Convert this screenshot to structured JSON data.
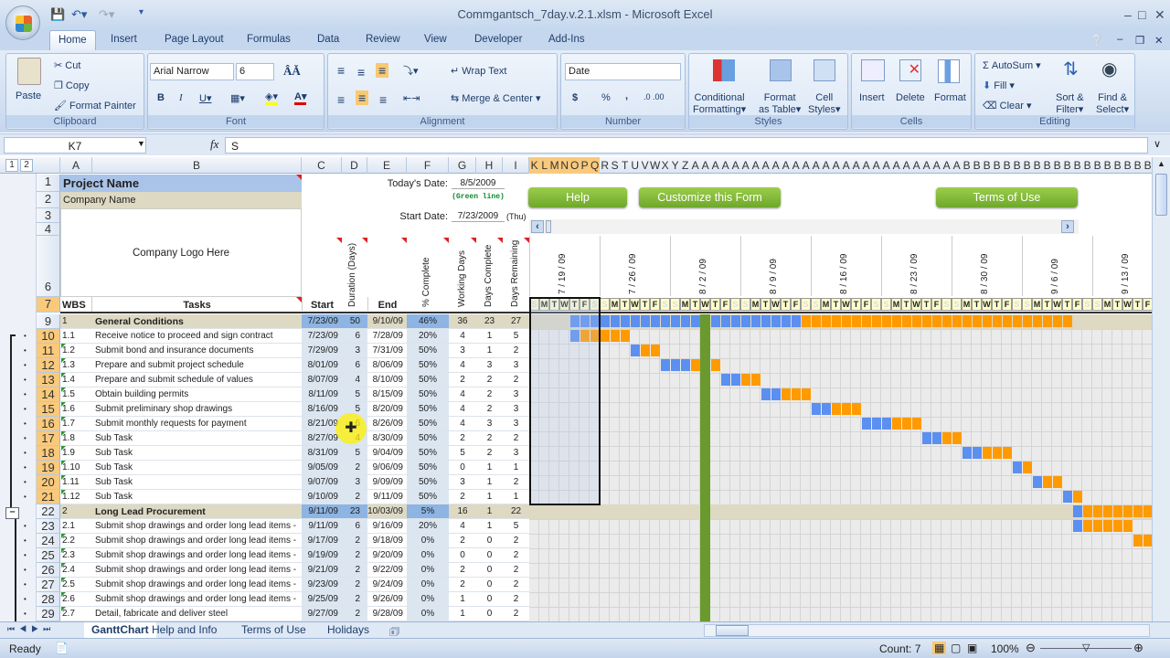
{
  "window": {
    "title": "Commgantsch_7day.v.2.1.xlsm - Microsoft Excel"
  },
  "ribbon": {
    "tabs": [
      "Home",
      "Insert",
      "Page Layout",
      "Formulas",
      "Data",
      "Review",
      "View",
      "Developer",
      "Add-Ins"
    ],
    "active_tab": "Home",
    "clipboard": {
      "label": "Clipboard",
      "paste": "Paste",
      "cut": "Cut",
      "copy": "Copy",
      "format_painter": "Format Painter"
    },
    "font": {
      "label": "Font",
      "font_name": "Arial Narrow",
      "font_size": "6"
    },
    "alignment": {
      "label": "Alignment",
      "wrap_text": "Wrap Text",
      "merge_center": "Merge & Center"
    },
    "number": {
      "label": "Number",
      "format": "Date",
      "currency": "$",
      "percent": "%",
      "comma": ","
    },
    "styles": {
      "label": "Styles",
      "conditional": "Conditional",
      "conditional2": "Formatting",
      "format_table": "Format",
      "format_table2": "as Table",
      "cell_styles": "Cell",
      "cell_styles2": "Styles"
    },
    "cells": {
      "label": "Cells",
      "insert": "Insert",
      "delete": "Delete",
      "format": "Format"
    },
    "editing": {
      "label": "Editing",
      "autosum": "AutoSum",
      "fill": "Fill",
      "clear": "Clear",
      "sort": "Sort &",
      "sort2": "Filter",
      "find": "Find &",
      "find2": "Select"
    }
  },
  "formula_bar": {
    "name_box": "K7",
    "fx": "fx",
    "value": "S"
  },
  "columns": {
    "fixed": [
      "A",
      "B",
      "C",
      "D",
      "E",
      "F",
      "G",
      "H",
      "I"
    ],
    "gantt": "KLMNOPQRSTUVWXYZAAAAAAAAAAAAAAAAAAAAAAAAAAABBBBBBBBBBBBBBBBBBBBB",
    "selected": "KLMNOPQ"
  },
  "outline_levels": [
    "1",
    "2"
  ],
  "sheet": {
    "project_name": "Project Name",
    "company_name": "Company Name",
    "logo_placeholder": "Company Logo Here",
    "todays_date_label": "Today's Date:",
    "todays_date": "8/5/2009",
    "green_line_note": "(Green line)",
    "start_date_label": "Start Date:",
    "start_date": "7/23/2009",
    "start_day": "(Thu)",
    "buttons": {
      "help": "Help",
      "customize": "Customize this Form",
      "terms": "Terms of Use"
    },
    "headers": {
      "wbs": "WBS",
      "tasks": "Tasks",
      "start": "Start",
      "duration": "Duration (Days)",
      "end": "End",
      "pct": "% Complete",
      "working": "Working Days",
      "complete": "Days Complete",
      "remaining": "Days Remaining"
    },
    "header_row_numbers": [
      "1",
      "2",
      "3",
      "4",
      "6",
      "7"
    ],
    "timeline_start": "2009-07-19",
    "today": "2009-08-05",
    "weeks": [
      "7 / 19 / 09",
      "7 / 26 / 09",
      "8 / 2 / 09",
      "8 / 9 / 09",
      "8 / 16 / 09",
      "8 / 23 / 09",
      "8 / 30 / 09",
      "9 / 6 / 09",
      "9 / 13 / 09"
    ],
    "day_letters": [
      "S",
      "M",
      "T",
      "W",
      "T",
      "F",
      "S"
    ],
    "colors": {
      "complete": "#5b8ff0",
      "remaining": "#ff9a00",
      "today_line": "#6a9a2e",
      "summary_row": "#ddd9c3",
      "date_col": "#dce6f1",
      "summary_date_col": "#8db4e2"
    },
    "rows": [
      {
        "row": "9",
        "wbs": "1",
        "task": "General Conditions",
        "start": "7/23/09",
        "dur": "50",
        "end": "9/10/09",
        "pct": "46%",
        "work": "36",
        "done": "23",
        "rem": "27",
        "summary": true,
        "iso": "2009-07-23"
      },
      {
        "row": "10",
        "wbs": "1.1",
        "task": "Receive notice to proceed and sign contract",
        "start": "7/23/09",
        "dur": "6",
        "end": "7/28/09",
        "pct": "20%",
        "work": "4",
        "done": "1",
        "rem": "5",
        "iso": "2009-07-23"
      },
      {
        "row": "11",
        "wbs": "1.2",
        "task": "Submit bond and insurance documents",
        "start": "7/29/09",
        "dur": "3",
        "end": "7/31/09",
        "pct": "50%",
        "work": "3",
        "done": "1",
        "rem": "2",
        "iso": "2009-07-29"
      },
      {
        "row": "12",
        "wbs": "1.3",
        "task": "Prepare and submit project schedule",
        "start": "8/01/09",
        "dur": "6",
        "end": "8/06/09",
        "pct": "50%",
        "work": "4",
        "done": "3",
        "rem": "3",
        "iso": "2009-08-01"
      },
      {
        "row": "13",
        "wbs": "1.4",
        "task": "Prepare and submit schedule of values",
        "start": "8/07/09",
        "dur": "4",
        "end": "8/10/09",
        "pct": "50%",
        "work": "2",
        "done": "2",
        "rem": "2",
        "iso": "2009-08-07"
      },
      {
        "row": "14",
        "wbs": "1.5",
        "task": "Obtain building permits",
        "start": "8/11/09",
        "dur": "5",
        "end": "8/15/09",
        "pct": "50%",
        "work": "4",
        "done": "2",
        "rem": "3",
        "iso": "2009-08-11"
      },
      {
        "row": "15",
        "wbs": "1.6",
        "task": "Submit preliminary shop drawings",
        "start": "8/16/09",
        "dur": "5",
        "end": "8/20/09",
        "pct": "50%",
        "work": "4",
        "done": "2",
        "rem": "3",
        "iso": "2009-08-16"
      },
      {
        "row": "16",
        "wbs": "1.7",
        "task": "Submit monthly requests for payment",
        "start": "8/21/09",
        "dur": "6",
        "end": "8/26/09",
        "pct": "50%",
        "work": "4",
        "done": "3",
        "rem": "3",
        "iso": "2009-08-21"
      },
      {
        "row": "17",
        "wbs": "1.8",
        "task": "Sub Task",
        "start": "8/27/09",
        "dur": "4",
        "end": "8/30/09",
        "pct": "50%",
        "work": "2",
        "done": "2",
        "rem": "2",
        "iso": "2009-08-27"
      },
      {
        "row": "18",
        "wbs": "1.9",
        "task": "Sub Task",
        "start": "8/31/09",
        "dur": "5",
        "end": "9/04/09",
        "pct": "50%",
        "work": "5",
        "done": "2",
        "rem": "3",
        "iso": "2009-08-31"
      },
      {
        "row": "19",
        "wbs": "1.10",
        "task": "Sub Task",
        "start": "9/05/09",
        "dur": "2",
        "end": "9/06/09",
        "pct": "50%",
        "work": "0",
        "done": "1",
        "rem": "1",
        "iso": "2009-09-05"
      },
      {
        "row": "20",
        "wbs": "1.11",
        "task": "Sub Task",
        "start": "9/07/09",
        "dur": "3",
        "end": "9/09/09",
        "pct": "50%",
        "work": "3",
        "done": "1",
        "rem": "2",
        "iso": "2009-09-07"
      },
      {
        "row": "21",
        "wbs": "1.12",
        "task": "Sub Task",
        "start": "9/10/09",
        "dur": "2",
        "end": "9/11/09",
        "pct": "50%",
        "work": "2",
        "done": "1",
        "rem": "1",
        "iso": "2009-09-10"
      },
      {
        "row": "22",
        "wbs": "2",
        "task": "Long Lead Procurement",
        "start": "9/11/09",
        "dur": "23",
        "end": "10/03/09",
        "pct": "5%",
        "work": "16",
        "done": "1",
        "rem": "22",
        "summary": true,
        "iso": "2009-09-11"
      },
      {
        "row": "23",
        "wbs": "2.1",
        "task": "Submit shop drawings and order long lead items -",
        "start": "9/11/09",
        "dur": "6",
        "end": "9/16/09",
        "pct": "20%",
        "work": "4",
        "done": "1",
        "rem": "5",
        "iso": "2009-09-11"
      },
      {
        "row": "24",
        "wbs": "2.2",
        "task": "Submit shop drawings and order long lead items -",
        "start": "9/17/09",
        "dur": "2",
        "end": "9/18/09",
        "pct": "0%",
        "work": "2",
        "done": "0",
        "rem": "2",
        "iso": "2009-09-17"
      },
      {
        "row": "25",
        "wbs": "2.3",
        "task": "Submit shop drawings and order long lead items -",
        "start": "9/19/09",
        "dur": "2",
        "end": "9/20/09",
        "pct": "0%",
        "work": "0",
        "done": "0",
        "rem": "2",
        "iso": "2009-09-19"
      },
      {
        "row": "26",
        "wbs": "2.4",
        "task": "Submit shop drawings and order long lead items -",
        "start": "9/21/09",
        "dur": "2",
        "end": "9/22/09",
        "pct": "0%",
        "work": "2",
        "done": "0",
        "rem": "2",
        "iso": "2009-09-21"
      },
      {
        "row": "27",
        "wbs": "2.5",
        "task": "Submit shop drawings and order long lead items -",
        "start": "9/23/09",
        "dur": "2",
        "end": "9/24/09",
        "pct": "0%",
        "work": "2",
        "done": "0",
        "rem": "2",
        "iso": "2009-09-23"
      },
      {
        "row": "28",
        "wbs": "2.6",
        "task": "Submit shop drawings and order long lead items -",
        "start": "9/25/09",
        "dur": "2",
        "end": "9/26/09",
        "pct": "0%",
        "work": "1",
        "done": "0",
        "rem": "2",
        "iso": "2009-09-25"
      },
      {
        "row": "29",
        "wbs": "2.7",
        "task": "Detail, fabricate and deliver steel",
        "start": "9/27/09",
        "dur": "2",
        "end": "9/28/09",
        "pct": "0%",
        "work": "1",
        "done": "0",
        "rem": "2",
        "iso": "2009-09-27"
      }
    ]
  },
  "sheet_tabs": [
    "GanttChart",
    "Help and Info",
    "Terms of Use",
    "Holidays"
  ],
  "active_sheet": "GanttChart",
  "status": {
    "ready": "Ready",
    "count": "Count: 7",
    "zoom": "100%"
  }
}
